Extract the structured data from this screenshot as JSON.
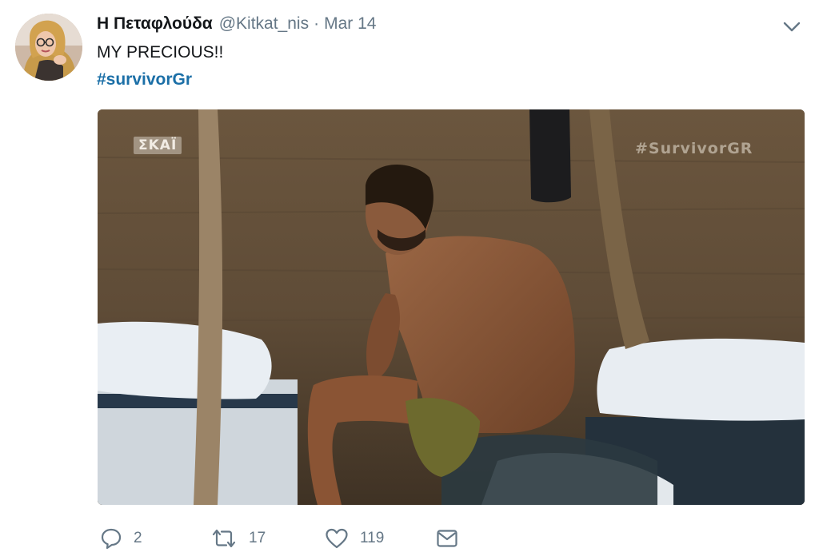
{
  "tweet": {
    "author": {
      "name": "Η Πεταφλούδα",
      "handle": "@Kitkat_nis"
    },
    "separator": "·",
    "timestamp": "Mar 14",
    "text": "MY PRECIOUS!!",
    "hashtag": "#survivorGr",
    "media": {
      "watermark_left": "ΣΚΑΪ",
      "watermark_right": "#SurvivorGR"
    },
    "actions": {
      "reply_count": "2",
      "retweet_count": "17",
      "like_count": "119"
    }
  },
  "icons": {
    "menu": "chevron-down-icon",
    "reply": "reply-bubble-icon",
    "retweet": "retweet-arrows-icon",
    "like": "heart-icon",
    "dm": "envelope-icon"
  },
  "colors": {
    "name": "#14171a",
    "meta": "#657786",
    "hashtag": "#1b6fa7"
  }
}
